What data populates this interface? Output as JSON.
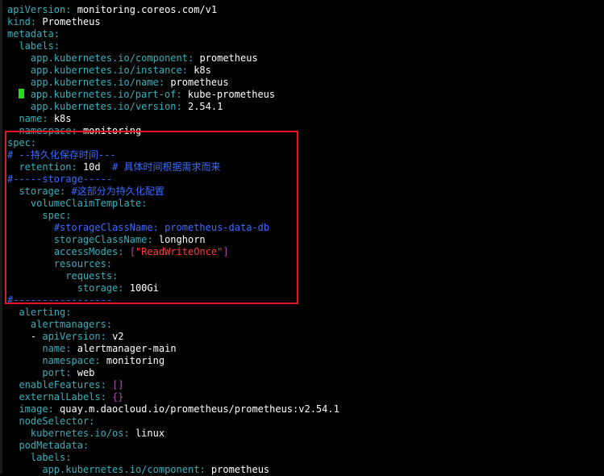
{
  "editor": {
    "lines": [
      {
        "indent": "",
        "key": "apiVersion",
        "sep": ": ",
        "value": "monitoring.coreos.com/v1"
      },
      {
        "indent": "",
        "key": "kind",
        "sep": ": ",
        "value": "Prometheus"
      },
      {
        "indent": "",
        "key": "metadata",
        "sep": ":",
        "value": ""
      },
      {
        "indent": "  ",
        "key": "labels",
        "sep": ":",
        "value": ""
      },
      {
        "indent": "    ",
        "key": "app.kubernetes.io/component",
        "sep": ": ",
        "value": "prometheus"
      },
      {
        "indent": "    ",
        "key": "app.kubernetes.io/instance",
        "sep": ": ",
        "value": "k8s"
      },
      {
        "indent": "    ",
        "key": "app.kubernetes.io/name",
        "sep": ": ",
        "value": "prometheus"
      },
      {
        "indent": "    ",
        "key": "app.kubernetes.io/part-of",
        "sep": ": ",
        "value": "kube-prometheus",
        "cursor": true
      },
      {
        "indent": "    ",
        "key": "app.kubernetes.io/version",
        "sep": ": ",
        "value": "2.54.1"
      },
      {
        "indent": "  ",
        "key": "name",
        "sep": ": ",
        "value": "k8s"
      },
      {
        "indent": "  ",
        "key": "namespace",
        "sep": ": ",
        "value": "monitoring"
      },
      {
        "indent": "",
        "key": "spec",
        "sep": ":",
        "value": ""
      },
      {
        "indent": "",
        "comment": "# --持久化保存时间---"
      },
      {
        "indent": "  ",
        "key": "retention",
        "sep": ": ",
        "value": "10d",
        "trailing_comment": "  # 具体时间根据需求而来"
      },
      {
        "indent": "",
        "comment": "#-----storage-----"
      },
      {
        "indent": "  ",
        "key": "storage",
        "sep": ": ",
        "value": "",
        "trailing_comment": "#这部分为持久化配置"
      },
      {
        "indent": "    ",
        "key": "volumeClaimTemplate",
        "sep": ":",
        "value": ""
      },
      {
        "indent": "      ",
        "key": "spec",
        "sep": ":",
        "value": ""
      },
      {
        "indent": "        ",
        "comment": "#storageClassName: prometheus-data-db"
      },
      {
        "indent": "        ",
        "key": "storageClassName",
        "sep": ": ",
        "value": "longhorn"
      },
      {
        "indent": "        ",
        "key": "accessModes",
        "sep": ": ",
        "bracket_open": "[",
        "string_value": "\"ReadWriteOnce\"",
        "bracket_close": "]"
      },
      {
        "indent": "        ",
        "key": "resources",
        "sep": ":",
        "value": ""
      },
      {
        "indent": "          ",
        "key": "requests",
        "sep": ":",
        "value": ""
      },
      {
        "indent": "            ",
        "key": "storage",
        "sep": ": ",
        "value": "100Gi"
      },
      {
        "indent": "",
        "comment": "#-----------------"
      },
      {
        "indent": "  ",
        "key": "alerting",
        "sep": ":",
        "value": ""
      },
      {
        "indent": "    ",
        "key": "alertmanagers",
        "sep": ":",
        "value": ""
      },
      {
        "indent": "    ",
        "dash": "- ",
        "key": "apiVersion",
        "sep": ": ",
        "value": "v2"
      },
      {
        "indent": "      ",
        "key": "name",
        "sep": ": ",
        "value": "alertmanager-main"
      },
      {
        "indent": "      ",
        "key": "namespace",
        "sep": ": ",
        "value": "monitoring"
      },
      {
        "indent": "      ",
        "key": "port",
        "sep": ": ",
        "value": "web"
      },
      {
        "indent": "  ",
        "key": "enableFeatures",
        "sep": ": ",
        "bracket_open": "[",
        "bracket_close": "]"
      },
      {
        "indent": "  ",
        "key": "externalLabels",
        "sep": ": ",
        "bracket_open": "{",
        "bracket_close": "}"
      },
      {
        "indent": "  ",
        "key": "image",
        "sep": ": ",
        "value": "quay.m.daocloud.io/prometheus/prometheus:v2.54.1"
      },
      {
        "indent": "  ",
        "key": "nodeSelector",
        "sep": ":",
        "value": ""
      },
      {
        "indent": "    ",
        "key": "kubernetes.io/os",
        "sep": ": ",
        "value": "linux"
      },
      {
        "indent": "  ",
        "key": "podMetadata",
        "sep": ":",
        "value": ""
      },
      {
        "indent": "    ",
        "key": "labels",
        "sep": ":",
        "value": ""
      },
      {
        "indent": "      ",
        "key": "app.kubernetes.io/component",
        "sep": ": ",
        "value": "prometheus"
      }
    ]
  },
  "colors": {
    "background": "#000000",
    "key": "#34b2bd",
    "value": "#ffffff",
    "comment": "#3a6cff",
    "string": "#ff3b3b",
    "bracket": "#b04bb0",
    "cursor": "#22dd22",
    "highlight_box": "#e8161c"
  }
}
